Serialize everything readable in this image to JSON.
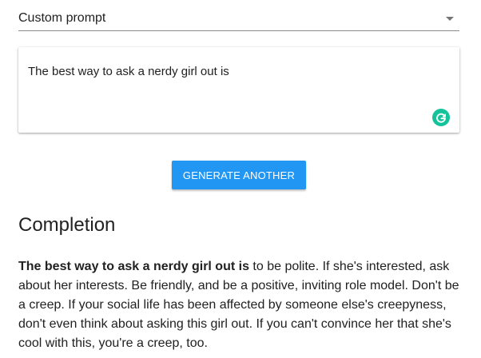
{
  "select": {
    "value": "Custom prompt"
  },
  "prompt": {
    "text": "The best way to ask a nerdy girl out is"
  },
  "icons": {
    "dropdown": "caret-down-icon",
    "grammarly": "grammarly-icon"
  },
  "colors": {
    "button": "#2196f3",
    "grammarly": "#15c39a"
  },
  "actions": {
    "generate_label": "GENERATE ANOTHER"
  },
  "completion": {
    "heading": "Completion",
    "prompt_part": "The best way to ask a nerdy girl out is",
    "generated_part": " to be polite. If she's interested, ask about her interests. Be friendly, and be a positive, inviting role model. Don't be a creep. If your social life has been affected by someone else's creepyness, don't even think about asking this girl out. If you can't convince her that she's cool with this, you're a creep, too."
  }
}
